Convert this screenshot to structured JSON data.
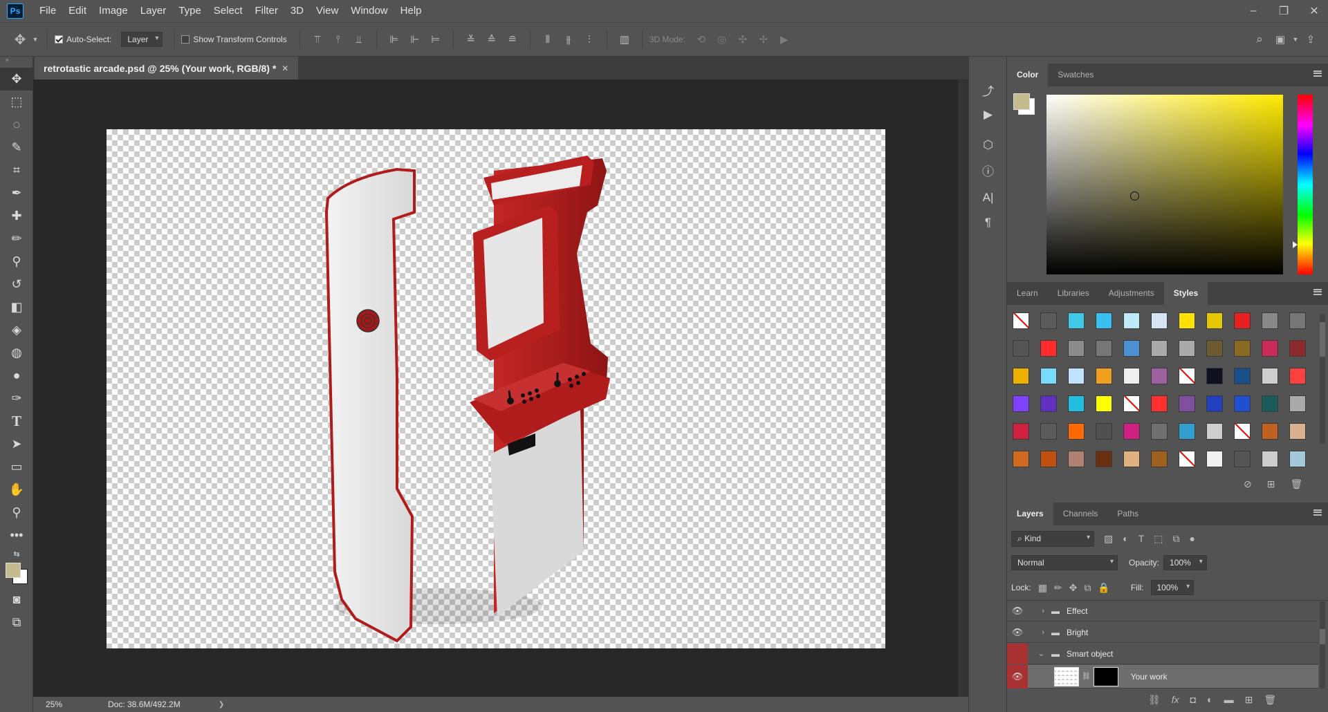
{
  "app": {
    "logo": "Ps"
  },
  "menu": [
    "File",
    "Edit",
    "Image",
    "Layer",
    "Type",
    "Select",
    "Filter",
    "3D",
    "View",
    "Window",
    "Help"
  ],
  "window_controls": {
    "minimize": "–",
    "restore": "❐",
    "close": "✕"
  },
  "options": {
    "auto_select_label": "Auto-Select:",
    "auto_select_value": "Layer",
    "show_transform_label": "Show Transform Controls",
    "mode_3d_label": "3D Mode:"
  },
  "document": {
    "tab_title": "retrotastic arcade.psd @ 25% (Your work, RGB/8) *",
    "close": "✕"
  },
  "status": {
    "zoom": "25%",
    "doc": "Doc: 38.6M/492.2M",
    "arrow": "❯"
  },
  "color_panel": {
    "tabs": [
      "Color",
      "Swatches"
    ],
    "foreground": "#c4bc8f",
    "background": "#ffffff"
  },
  "styles_panel": {
    "tabs": [
      "Learn",
      "Libraries",
      "Adjustments",
      "Styles"
    ]
  },
  "layers_panel": {
    "tabs": [
      "Layers",
      "Channels",
      "Paths"
    ],
    "kind_label": "Kind",
    "blend_mode": "Normal",
    "opacity_label": "Opacity:",
    "opacity_value": "100%",
    "lock_label": "Lock:",
    "fill_label": "Fill:",
    "fill_value": "100%",
    "layers": [
      {
        "name": "Effect"
      },
      {
        "name": "Bright"
      },
      {
        "name": "Smart object"
      },
      {
        "name": "Your work"
      }
    ]
  },
  "style_swatches": [
    "none",
    "#5a5a5a",
    "#3fc8e8",
    "#38c1f0",
    "#bfe9f7",
    "#d4e4f4",
    "#ffe000",
    "#e6c800",
    "#e62020",
    "#888",
    "#777",
    "#555",
    "#ff2a2a",
    "#8c8c8c",
    "#777",
    "#4f8fd6",
    "#aaa",
    "#aaa",
    "#6b5a2e",
    "#8a6a20",
    "#cc2a5a",
    "#8a2a2a",
    "#f0b000",
    "#7ad9ff",
    "#bfe3ff",
    "#f0a020",
    "#eee",
    "#a060a0",
    "none",
    "#101020",
    "#1a4e8a",
    "#cfcfcf",
    "#ff4040",
    "#8040ff",
    "#6030c0",
    "#1fbfe0",
    "#ffff00",
    "none",
    "#ff3030",
    "#8050a0",
    "#2040c0",
    "#2050d0",
    "#1a5a5a",
    "#aaa",
    "#d02040",
    "#5a5a5a",
    "#ff6a00",
    "#505050",
    "#d02080",
    "#707070",
    "#30a0d0",
    "#cfcfcf",
    "none",
    "#c06020",
    "#d8b090",
    "#d06a20",
    "#c05010",
    "#b08070",
    "#6a3010",
    "#e0b080",
    "#a06020",
    "none",
    "#f0f0f0",
    "#555",
    "#ccc",
    "#a0c8d8"
  ]
}
